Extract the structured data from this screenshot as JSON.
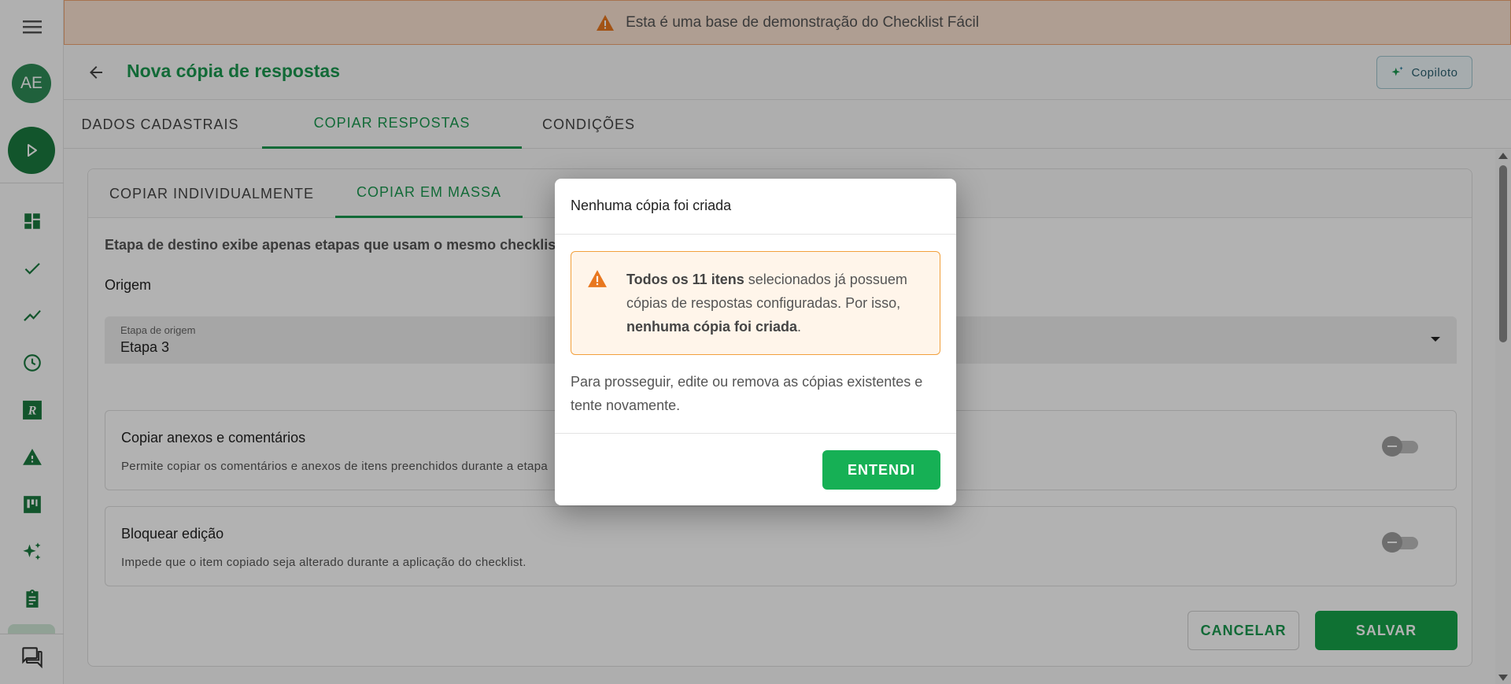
{
  "banner": {
    "text": "Esta é uma base de demonstração do Checklist Fácil"
  },
  "sidebar": {
    "avatar_initials": "AE",
    "items": [
      {
        "icon": "dashboard-icon"
      },
      {
        "icon": "check-icon"
      },
      {
        "icon": "trending-icon"
      },
      {
        "icon": "clock-icon"
      },
      {
        "icon": "r-logo-icon"
      },
      {
        "icon": "warning-icon"
      },
      {
        "icon": "kanban-icon"
      },
      {
        "icon": "sparkles-icon"
      },
      {
        "icon": "clipboard-icon"
      },
      {
        "icon": "chat-icon"
      }
    ]
  },
  "header": {
    "title": "Nova cópia de respostas",
    "copilot_label": "Copiloto"
  },
  "tabs": [
    "DADOS CADASTRAIS",
    "COPIAR RESPOSTAS",
    "CONDIÇÕES"
  ],
  "subtabs": [
    "COPIAR INDIVIDUALMENTE",
    "COPIAR EM MASSA"
  ],
  "form": {
    "info_text": "Etapa de destino exibe apenas etapas que usam o mesmo checklist",
    "origin_section": "Origem",
    "origin_select_label": "Etapa de origem",
    "origin_select_value": "Etapa 3",
    "options": [
      {
        "title": "Copiar anexos e comentários",
        "description": "Permite copiar os comentários e anexos de itens preenchidos durante a etapa"
      },
      {
        "title": "Bloquear edição",
        "description": "Impede que o item copiado seja alterado durante a aplicação do checklist."
      }
    ],
    "cancel_label": "CANCELAR",
    "save_label": "SALVAR"
  },
  "modal": {
    "title": "Nenhuma cópia foi criada",
    "alert": {
      "bold_start": "Todos os 11 itens",
      "text_middle": " selecionados já possuem cópias de respostas configuradas. Por isso, ",
      "bold_end": "nenhuma cópia foi criada",
      "text_end": "."
    },
    "body": "Para prosseguir, edite ou remova as cópias existentes e tente novamente.",
    "ok_label": "ENTENDI"
  },
  "colors": {
    "brand_green": "#1a9850",
    "button_green": "#16a34a",
    "warning_orange": "#e8771f"
  }
}
